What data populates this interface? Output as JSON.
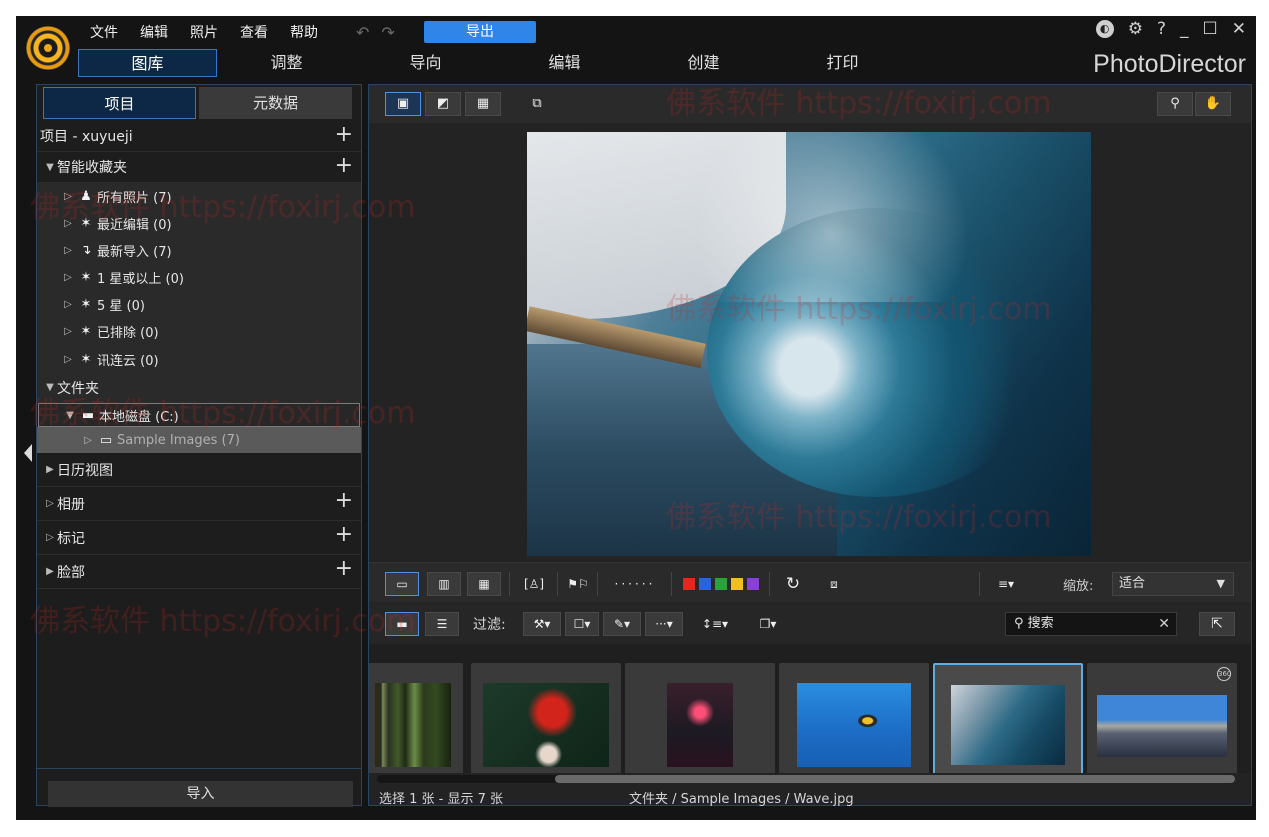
{
  "app": {
    "brand": "PhotoDirector"
  },
  "menu": [
    "文件",
    "编辑",
    "照片",
    "查看",
    "帮助"
  ],
  "toolbar": {
    "undo": "↶",
    "redo": "↷",
    "export_label": "导出"
  },
  "window_controls": {
    "account": "◐",
    "settings": "⚙",
    "help": "?",
    "minimize": "_",
    "maximize": "☐",
    "close": "✕"
  },
  "modules": [
    "图库",
    "调整",
    "导向",
    "编辑",
    "创建",
    "打印"
  ],
  "side_tabs": [
    "项目",
    "元数据"
  ],
  "tree": {
    "project": "项目 - xuyueji",
    "smart_collections": "智能收藏夹",
    "smart_items": [
      {
        "label": "所有照片 (7)",
        "icon": "people-icon"
      },
      {
        "label": "最近编辑 (0)",
        "icon": "sparkle-icon"
      },
      {
        "label": "最新导入 (7)",
        "icon": "import-arrow-icon"
      },
      {
        "label": "1 星或以上 (0)",
        "icon": "sparkle-icon"
      },
      {
        "label": "5 星 (0)",
        "icon": "sparkle-icon"
      },
      {
        "label": "已排除 (0)",
        "icon": "sparkle-icon"
      },
      {
        "label": "讯连云 (0)",
        "icon": "sparkle-icon"
      }
    ],
    "folders": "文件夹",
    "drive": "本地磁盘 (C:)",
    "sample_folder": "Sample Images (7)",
    "calendar": "日历视图",
    "albums": "相册",
    "tags": "标记",
    "faces": "脸部"
  },
  "import_label": "导入",
  "strip": {
    "filter_label": "过滤:",
    "zoom_label": "缩放:",
    "zoom_value": "适合",
    "search_placeholder": "搜索",
    "colors": [
      "#e8251f",
      "#2764e0",
      "#2aa33a",
      "#f2c01c",
      "#8a3fd8"
    ]
  },
  "status": {
    "left": "选择 1 张 - 显示 7 张",
    "right": "文件夹 / Sample Images / Wave.jpg"
  },
  "watermark": [
    "佛系软件 https://foxirj.com",
    "佛系软件 https://foxirj.com",
    "佛系软件 https://foxirj.com",
    "佛系软件 https://foxirj.com",
    "佛系软件 https://foxirj.com",
    "佛系软件 https://foxirj.com"
  ]
}
